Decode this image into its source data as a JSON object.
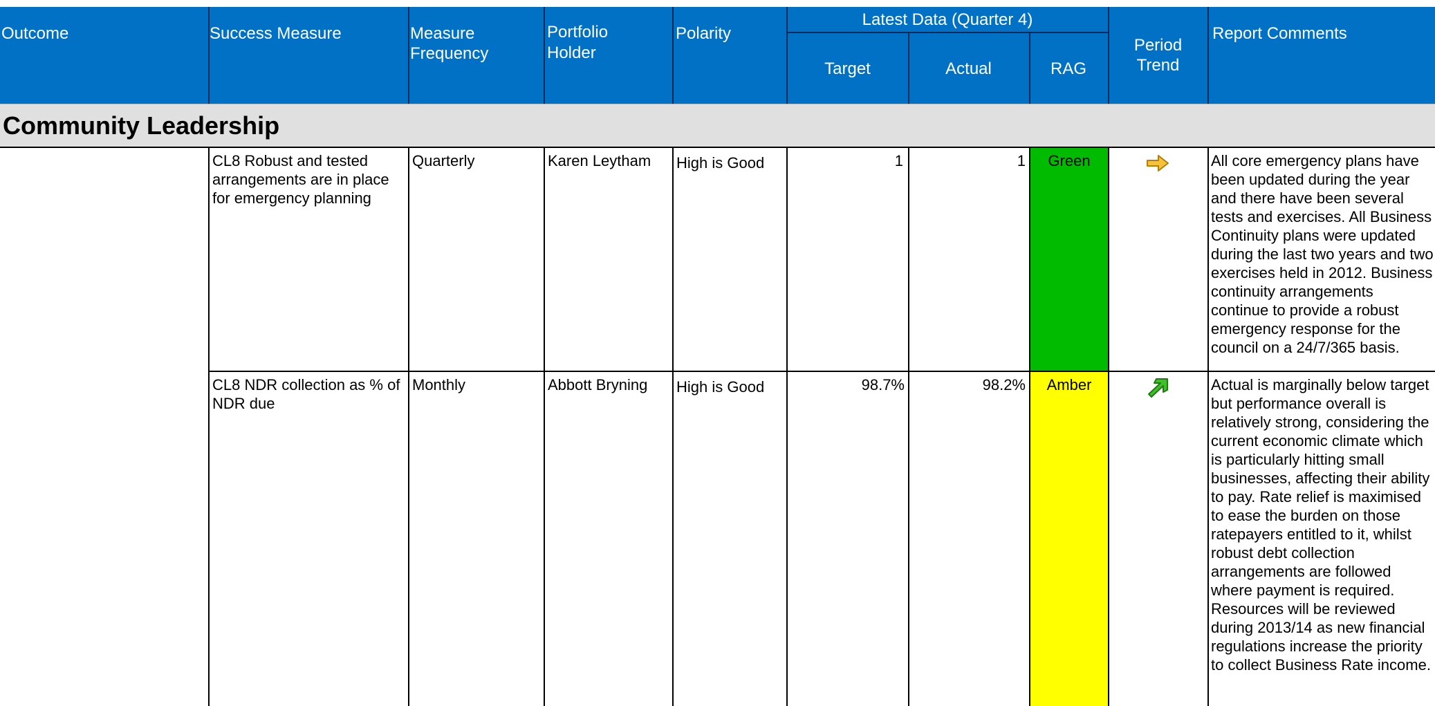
{
  "header": {
    "outcome": "Outcome",
    "success_measure": "Success Measure",
    "measure_frequency": "Measure Frequency",
    "portfolio_holder": "Portfolio Holder",
    "polarity": "Polarity",
    "latest_data": "Latest Data (Quarter 4)",
    "target": "Target",
    "actual": "Actual",
    "rag": "RAG",
    "period_trend": "Period Trend",
    "report_comments": "Report Comments"
  },
  "section": {
    "title": "Community Leadership"
  },
  "rows": [
    {
      "outcome": "",
      "measure": "CL8 Robust and tested arrangements are in place for emergency planning",
      "frequency": "Quarterly",
      "holder": "Karen Leytham",
      "polarity": "High is Good",
      "target": "1",
      "actual": "1",
      "rag": "Green",
      "rag_color": "#00bb00",
      "trend_icon": "right-arrow-icon",
      "comments": "All core emergency plans have been updated during the year and there have been several tests and exercises. All Business Continuity plans were updated during the last two years and two exercises held in 2012. Business continuity arrangements continue to provide a robust emergency response for the council on a 24/7/365 basis."
    },
    {
      "outcome": "",
      "measure": "CL8 NDR collection as % of NDR due",
      "frequency": "Monthly",
      "holder": "Abbott Bryning",
      "polarity": "High is Good",
      "target": "98.7%",
      "actual": "98.2%",
      "rag": "Amber",
      "rag_color": "#ffff00",
      "trend_icon": "up-right-arrow-icon",
      "comments": "Actual is marginally below target but performance overall is relatively strong, considering the current economic climate which is particularly hitting small businesses, affecting their ability to pay. Rate relief is maximised to ease the burden on those ratepayers entitled to it, whilst robust debt collection arrangements are followed where payment is required. Resources will be reviewed during 2013/14 as new financial regulations increase the priority to collect Business Rate income."
    }
  ],
  "colors": {
    "header_bg": "#0071c5",
    "section_bg": "#e0e0e0",
    "green": "#00bb00",
    "amber": "#ffff00"
  }
}
